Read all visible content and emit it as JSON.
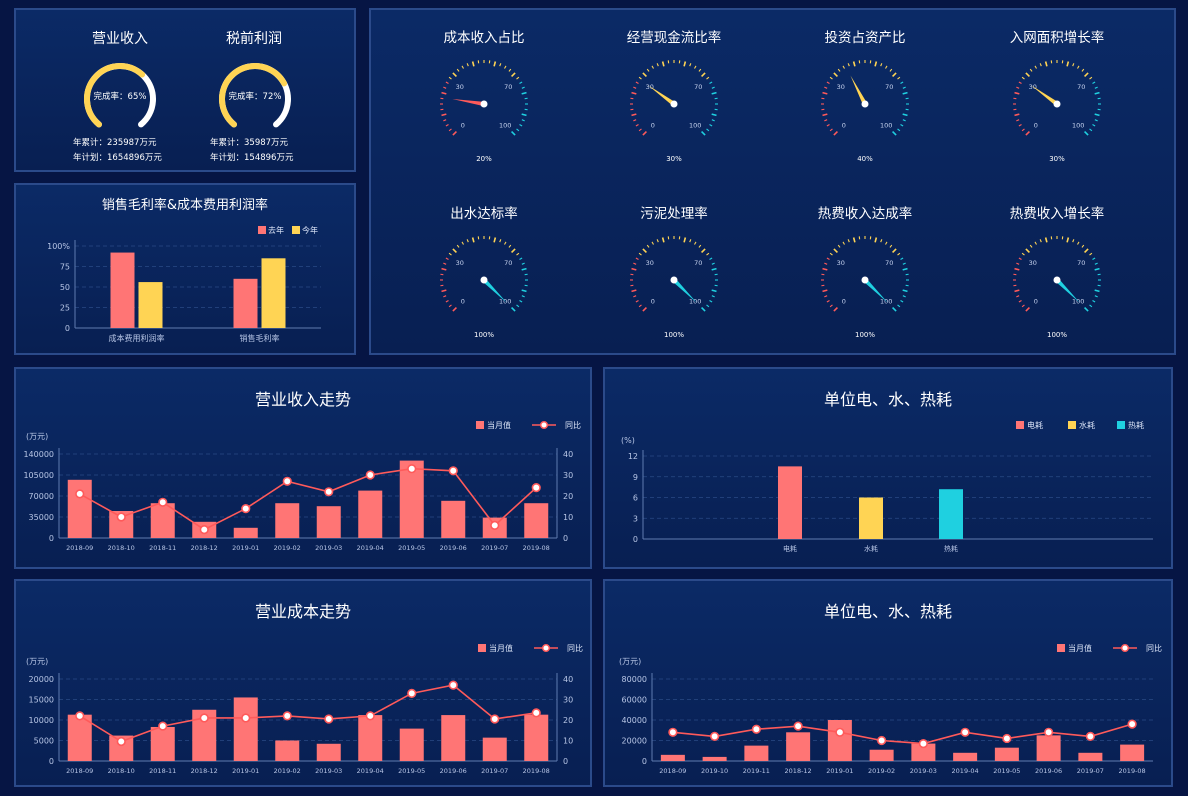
{
  "kpi": {
    "cards": [
      {
        "title": "营业收入",
        "rate_text": "完成率：65%",
        "rate": 0.65,
        "year_total": "年累计：235987万元",
        "year_plan": "年计划：1654896万元"
      },
      {
        "title": "税前利润",
        "rate_text": "完成率：72%",
        "rate": 0.72,
        "year_total": "年累计：35987万元",
        "year_plan": "年计划：154896万元"
      }
    ]
  },
  "colors": {
    "salmon": "#ff7575",
    "yellow": "#ffd454",
    "cyan": "#1fd0e0",
    "axis": "#5f7bb0",
    "grid": "#2a4a85"
  },
  "gauges": [
    {
      "title": "成本收入占比",
      "value": 20,
      "label": "20%"
    },
    {
      "title": "经营现金流比率",
      "value": 30,
      "label": "30%"
    },
    {
      "title": "投资占资产比",
      "value": 40,
      "label": "40%"
    },
    {
      "title": "入网面积增长率",
      "value": 30,
      "label": "30%"
    },
    {
      "title": "出水达标率",
      "value": 100,
      "label": "100%"
    },
    {
      "title": "污泥处理率",
      "value": 100,
      "label": "100%"
    },
    {
      "title": "热费收入达成率",
      "value": 100,
      "label": "100%"
    },
    {
      "title": "热费收入增长率",
      "value": 100,
      "label": "100%"
    }
  ],
  "gauge_ticks": [
    "0",
    "30",
    "70",
    "100"
  ],
  "chart_data": [
    {
      "id": "margin",
      "type": "bar",
      "title": "销售毛利率&成本费用利润率",
      "categories": [
        "成本费用利润率",
        "销售毛利率"
      ],
      "series": [
        {
          "name": "去年",
          "values": [
            92,
            60
          ]
        },
        {
          "name": "今年",
          "values": [
            56,
            85
          ]
        }
      ],
      "ylim": [
        0,
        100
      ],
      "yticks": [
        "0",
        "25",
        "50",
        "75",
        "100%"
      ],
      "ytick_values": [
        0,
        25,
        50,
        75,
        100
      ]
    },
    {
      "id": "revenue",
      "type": "bar+line",
      "title": "营业收入走势",
      "ylabel": "(万元)",
      "categories": [
        "2018-09",
        "2018-10",
        "2018-11",
        "2018-12",
        "2019-01",
        "2019-02",
        "2019-03",
        "2019-04",
        "2019-05",
        "2019-06",
        "2019-07",
        "2019-08"
      ],
      "bar_series": {
        "name": "当月值",
        "values": [
          97000,
          45000,
          58000,
          27000,
          17000,
          58000,
          53000,
          79000,
          129000,
          62000,
          34000,
          58000
        ]
      },
      "line_series": {
        "name": "同比",
        "values": [
          21,
          10,
          17,
          4,
          14,
          27,
          22,
          30,
          33,
          32,
          6,
          24
        ]
      },
      "ylim": [
        0,
        140000
      ],
      "yticks": [
        "0",
        "35000",
        "70000",
        "105000",
        "140000"
      ],
      "ytick_values": [
        0,
        35000,
        70000,
        105000,
        140000
      ],
      "y2lim": [
        0,
        40
      ],
      "y2ticks": [
        "0",
        "10",
        "20",
        "30",
        "40"
      ],
      "y2tick_values": [
        0,
        10,
        20,
        30,
        40
      ]
    },
    {
      "id": "unit",
      "type": "bar",
      "title": "单位电、水、热耗",
      "ylabel": "(%)",
      "categories": [
        "电耗",
        "水耗",
        "热耗"
      ],
      "series": [
        {
          "name": "电耗",
          "values": [
            10.5
          ]
        },
        {
          "name": "水耗",
          "values": [
            6
          ]
        },
        {
          "name": "热耗",
          "values": [
            7.2
          ]
        }
      ],
      "ylim": [
        0,
        12
      ],
      "yticks": [
        "0",
        "3",
        "6",
        "9",
        "12"
      ],
      "ytick_values": [
        0,
        3,
        6,
        9,
        12
      ]
    },
    {
      "id": "cost",
      "type": "bar+line",
      "title": "营业成本走势",
      "ylabel": "(万元)",
      "categories": [
        "2018-09",
        "2018-10",
        "2018-11",
        "2018-12",
        "2019-01",
        "2019-02",
        "2019-03",
        "2019-04",
        "2019-05",
        "2019-06",
        "2019-07",
        "2019-08"
      ],
      "bar_series": {
        "name": "当月值",
        "values": [
          11300,
          6200,
          8300,
          12500,
          15500,
          5000,
          4200,
          11200,
          7900,
          11200,
          5700,
          11300
        ]
      },
      "line_series": {
        "name": "同比",
        "values": [
          22,
          9.5,
          17,
          21,
          21,
          22,
          20.5,
          22,
          33,
          37,
          20.5,
          23.5
        ]
      },
      "ylim": [
        0,
        20000
      ],
      "yticks": [
        "0",
        "5000",
        "10000",
        "15000",
        "20000"
      ],
      "ytick_values": [
        0,
        5000,
        10000,
        15000,
        20000
      ],
      "y2lim": [
        0,
        40
      ],
      "y2ticks": [
        "0",
        "10",
        "20",
        "30",
        "40"
      ],
      "y2tick_values": [
        0,
        10,
        20,
        30,
        40
      ]
    },
    {
      "id": "unit2",
      "type": "bar+line",
      "title": "单位电、水、热耗",
      "ylabel": "(万元)",
      "categories": [
        "2018-09",
        "2019-10",
        "2019-11",
        "2018-12",
        "2019-01",
        "2019-02",
        "2019-03",
        "2019-04",
        "2019-05",
        "2019-06",
        "2019-07",
        "2019-08"
      ],
      "bar_series": {
        "name": "当月值",
        "values": [
          6000,
          4000,
          15000,
          28000,
          40000,
          11000,
          17000,
          8000,
          13000,
          25000,
          8000,
          16000
        ]
      },
      "line_series": {
        "name": "同比",
        "values": [
          28000,
          24000,
          31000,
          34000,
          28000,
          20000,
          17000,
          28000,
          22000,
          28000,
          24000,
          36000
        ]
      },
      "ylim": [
        0,
        80000
      ],
      "yticks": [
        "0",
        "20000",
        "40000",
        "60000",
        "80000"
      ],
      "ytick_values": [
        0,
        20000,
        40000,
        60000,
        80000
      ]
    }
  ]
}
